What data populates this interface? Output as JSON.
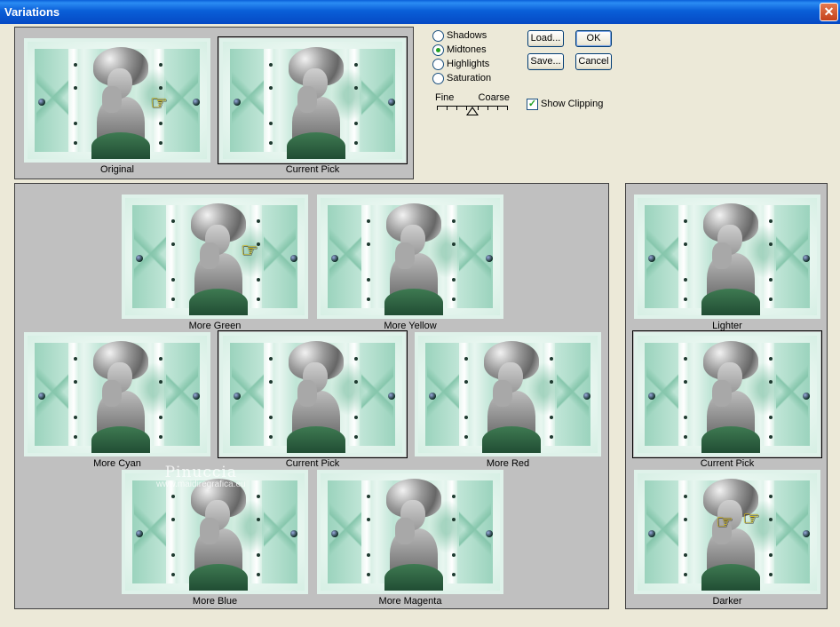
{
  "window": {
    "title": "Variations",
    "close_glyph": "✕"
  },
  "top_panel": {
    "original": {
      "label": "Original"
    },
    "current_pick": {
      "label": "Current Pick"
    }
  },
  "tone_options": {
    "items": [
      "Shadows",
      "Midtones",
      "Highlights",
      "Saturation"
    ],
    "selected": "Midtones"
  },
  "buttons": {
    "load": "Load...",
    "save": "Save...",
    "ok": "OK",
    "cancel": "Cancel"
  },
  "slider": {
    "left_label": "Fine",
    "right_label": "Coarse",
    "position_fraction": 0.5
  },
  "show_clipping": {
    "label": "Show Clipping",
    "checked": true,
    "check_glyph": "✓"
  },
  "color_panel": {
    "thumbs": [
      {
        "label": "More Green"
      },
      {
        "label": "More Yellow"
      },
      {
        "label": "More Cyan"
      },
      {
        "label": "Current Pick"
      },
      {
        "label": "More Red"
      },
      {
        "label": "More Blue"
      },
      {
        "label": "More Magenta"
      }
    ]
  },
  "brightness_panel": {
    "thumbs": [
      {
        "label": "Lighter"
      },
      {
        "label": "Current Pick"
      },
      {
        "label": "Darker"
      }
    ]
  },
  "watermark": {
    "name": "Pinuccia",
    "url": "www.maidiregrafica.eu"
  },
  "pointer_glyph": "☞",
  "colors": {
    "accent": "#0a5fd8",
    "panel_bg": "#c0c0c0",
    "dialog_bg": "#ece9d8"
  }
}
